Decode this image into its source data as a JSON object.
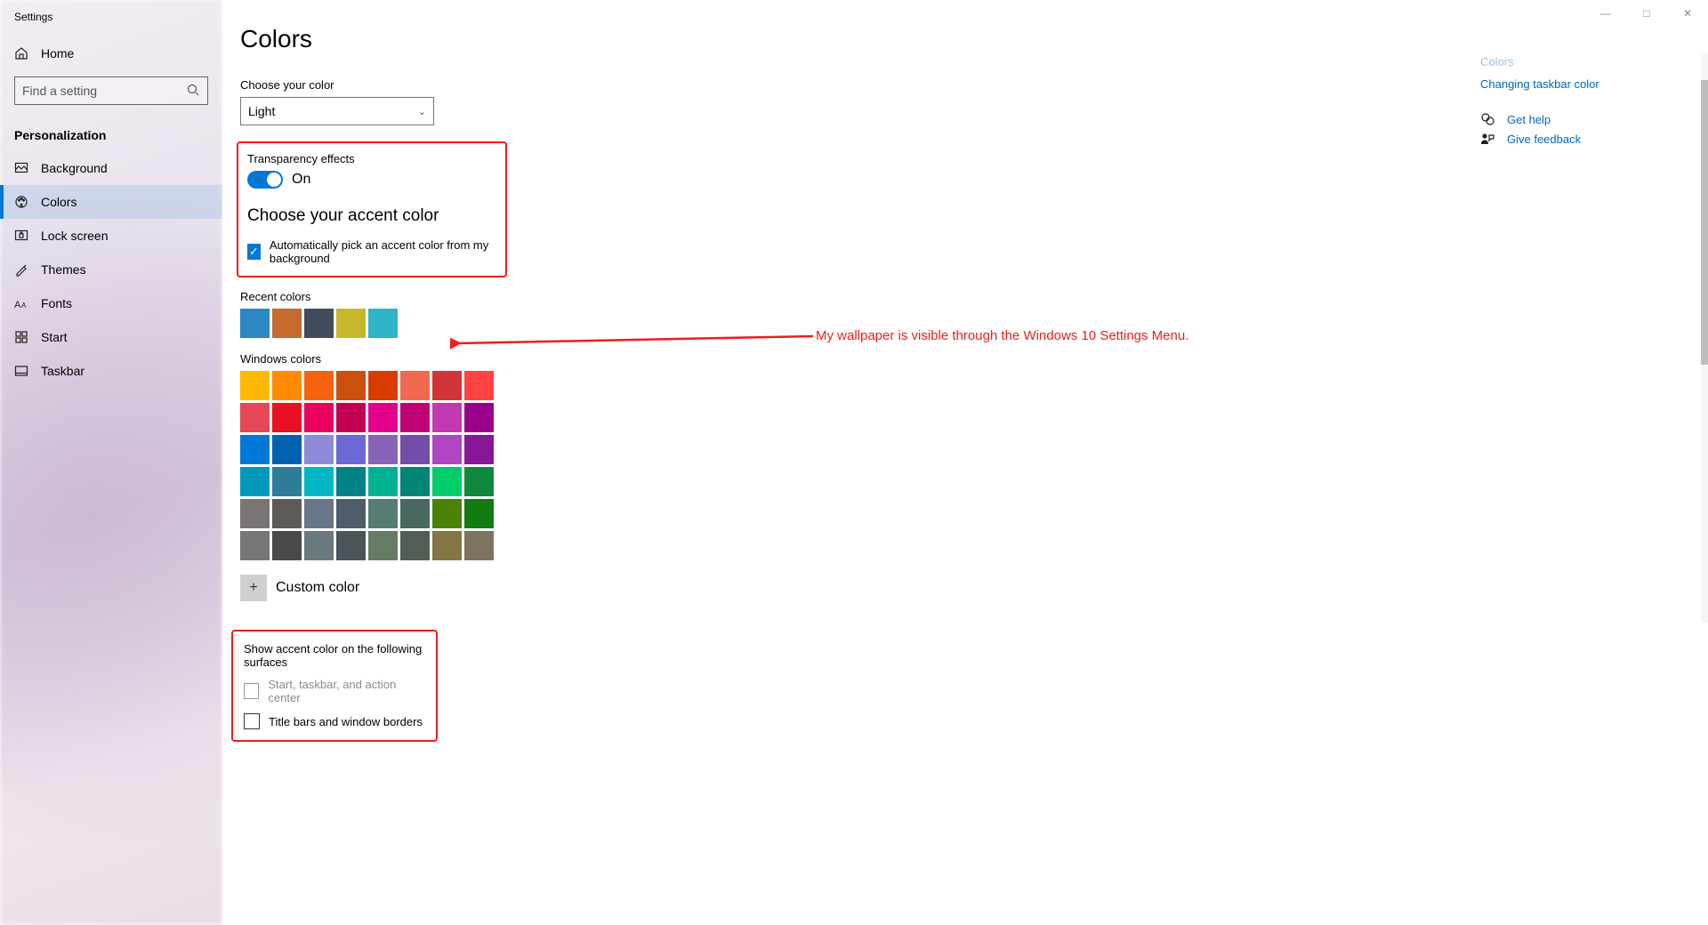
{
  "window": {
    "title": "Settings",
    "controls": {
      "minimize": "—",
      "maximize": "□",
      "close": "✕"
    }
  },
  "sidebar": {
    "home": "Home",
    "search_placeholder": "Find a setting",
    "section": "Personalization",
    "items": [
      {
        "id": "background",
        "label": "Background"
      },
      {
        "id": "colors",
        "label": "Colors"
      },
      {
        "id": "lock-screen",
        "label": "Lock screen"
      },
      {
        "id": "themes",
        "label": "Themes"
      },
      {
        "id": "fonts",
        "label": "Fonts"
      },
      {
        "id": "start",
        "label": "Start"
      },
      {
        "id": "taskbar",
        "label": "Taskbar"
      }
    ],
    "active_id": "colors"
  },
  "page": {
    "title": "Colors",
    "choose_color_label": "Choose your color",
    "choose_color_value": "Light",
    "transparency_label": "Transparency effects",
    "transparency_state": "On",
    "accent_heading": "Choose your accent color",
    "auto_pick_label": "Automatically pick an accent color from my background",
    "auto_pick_checked": true,
    "recent_label": "Recent colors",
    "recent_colors": [
      "#2b88c5",
      "#c56b2d",
      "#414c5c",
      "#c7b82b",
      "#2eb3c7"
    ],
    "windows_colors_label": "Windows colors",
    "windows_colors": [
      "#ffb900",
      "#ff8c00",
      "#f7630c",
      "#ca5010",
      "#da3b01",
      "#ef6950",
      "#d13438",
      "#ff4343",
      "#e74856",
      "#e81123",
      "#ea005e",
      "#c30052",
      "#e3008c",
      "#bf0077",
      "#c239b3",
      "#9a0089",
      "#0078d7",
      "#0063b1",
      "#8e8cd8",
      "#6b69d6",
      "#8764b8",
      "#744da9",
      "#b146c2",
      "#881798",
      "#0099bc",
      "#2d7d9a",
      "#00b7c3",
      "#038387",
      "#00b294",
      "#018574",
      "#00cc6a",
      "#10893e",
      "#7a7574",
      "#5d5a58",
      "#68768a",
      "#515c6b",
      "#567c73",
      "#486860",
      "#498205",
      "#107c10",
      "#767676",
      "#4c4a48",
      "#69797e",
      "#4a5459",
      "#647c64",
      "#525e54",
      "#847545",
      "#7e735f"
    ],
    "custom_color_label": "Custom color",
    "surfaces_heading": "Show accent color on the following surfaces",
    "surface_start": {
      "label": "Start, taskbar, and action center",
      "enabled": false,
      "checked": false
    },
    "surface_title": {
      "label": "Title bars and window borders",
      "enabled": true,
      "checked": false
    }
  },
  "rail": {
    "partial_link": "Colors",
    "link_taskbar": "Changing taskbar color",
    "get_help": "Get help",
    "give_feedback": "Give feedback"
  },
  "annotation": {
    "text": "My wallpaper is visible through the Windows 10 Settings Menu."
  }
}
